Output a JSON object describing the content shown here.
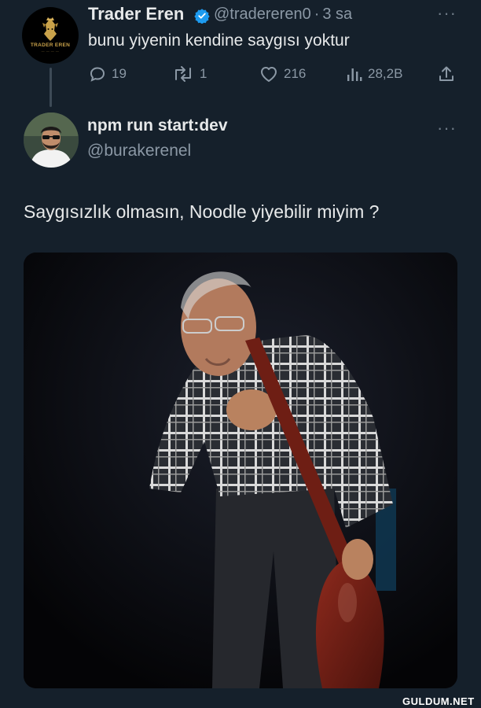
{
  "tweet1": {
    "author_name": "Trader Eren",
    "handle": "@tradereren0",
    "separator": "·",
    "time": "3 sa",
    "text": "bunu yiyenin kendine saygısı yoktur",
    "avatar_brand": "TRADER EREN",
    "replies": "19",
    "retweets": "1",
    "likes": "216",
    "views": "28,2B",
    "icons": [
      "reply-icon",
      "retweet-icon",
      "like-icon",
      "views-icon",
      "share-icon",
      "more-icon",
      "verified-badge-icon"
    ]
  },
  "tweet2": {
    "author_name": "npm run start:dev",
    "handle": "@burakerenel",
    "text": "Saygısızlık olmasın, Noodle yiyebilir miyim ?",
    "icons": [
      "more-icon"
    ]
  },
  "watermark": "GULDUM.NET",
  "colors": {
    "background": "#15202b",
    "text": "#e7e9ea",
    "muted": "#8b98a5",
    "verified": "#1d9bf0",
    "gold": "#c9a24a"
  }
}
